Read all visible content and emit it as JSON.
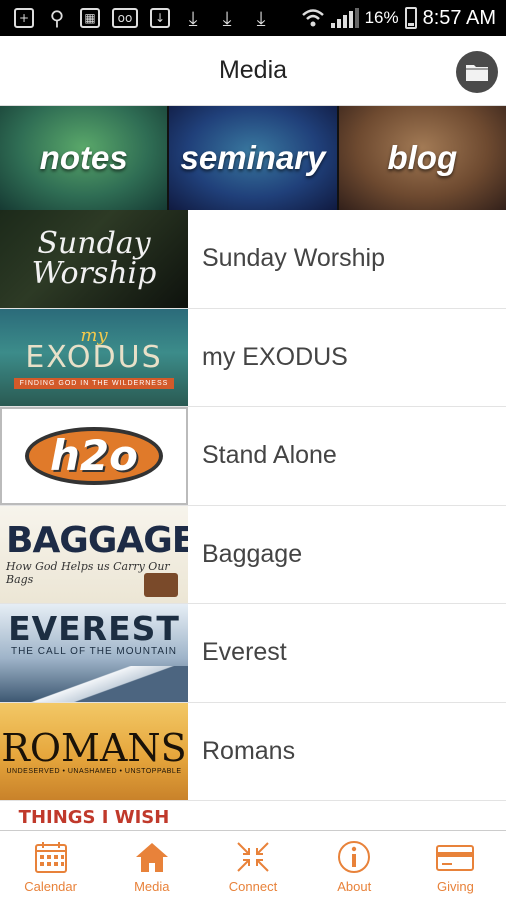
{
  "status_bar": {
    "battery": "16%",
    "time": "8:57 AM",
    "icons": [
      "add-icon",
      "usb-icon",
      "sim-icon",
      "voicemail-icon",
      "download-icon",
      "download-icon",
      "download-icon",
      "download-icon",
      "wifi-icon",
      "signal-icon",
      "battery-icon"
    ]
  },
  "header": {
    "title": "Media",
    "action_icon": "folder-icon"
  },
  "category_tiles": [
    {
      "label": "notes"
    },
    {
      "label": "seminary"
    },
    {
      "label": "blog"
    }
  ],
  "series": [
    {
      "label": "Sunday Worship",
      "thumb_line1": "Sunday",
      "thumb_line2": "Worship"
    },
    {
      "label": "my EXODUS",
      "thumb_small": "my",
      "thumb_title": "EXODUS",
      "thumb_band": "FINDING GOD IN THE WILDERNESS"
    },
    {
      "label": "Stand Alone",
      "thumb_title": "h2o"
    },
    {
      "label": "Baggage",
      "thumb_title": "BAGGAGE",
      "thumb_sub": "How God Helps us Carry Our Bags"
    },
    {
      "label": "Everest",
      "thumb_title": "EVEREST",
      "thumb_sub": "THE CALL OF THE MOUNTAIN"
    },
    {
      "label": "Romans",
      "thumb_title": "ROMANS",
      "thumb_sub": "UNDESERVED • UNASHAMED • UNSTOPPABLE"
    },
    {
      "label": "",
      "thumb_title": "THINGS I WISH"
    }
  ],
  "bottom_nav": [
    {
      "label": "Calendar",
      "icon": "calendar-icon"
    },
    {
      "label": "Media",
      "icon": "home-icon",
      "active": true
    },
    {
      "label": "Connect",
      "icon": "connect-icon"
    },
    {
      "label": "About",
      "icon": "info-icon"
    },
    {
      "label": "Giving",
      "icon": "card-icon"
    }
  ],
  "colors": {
    "accent": "#E8823A",
    "status_bar": "#000000",
    "folder_button": "#4A4A4A"
  }
}
